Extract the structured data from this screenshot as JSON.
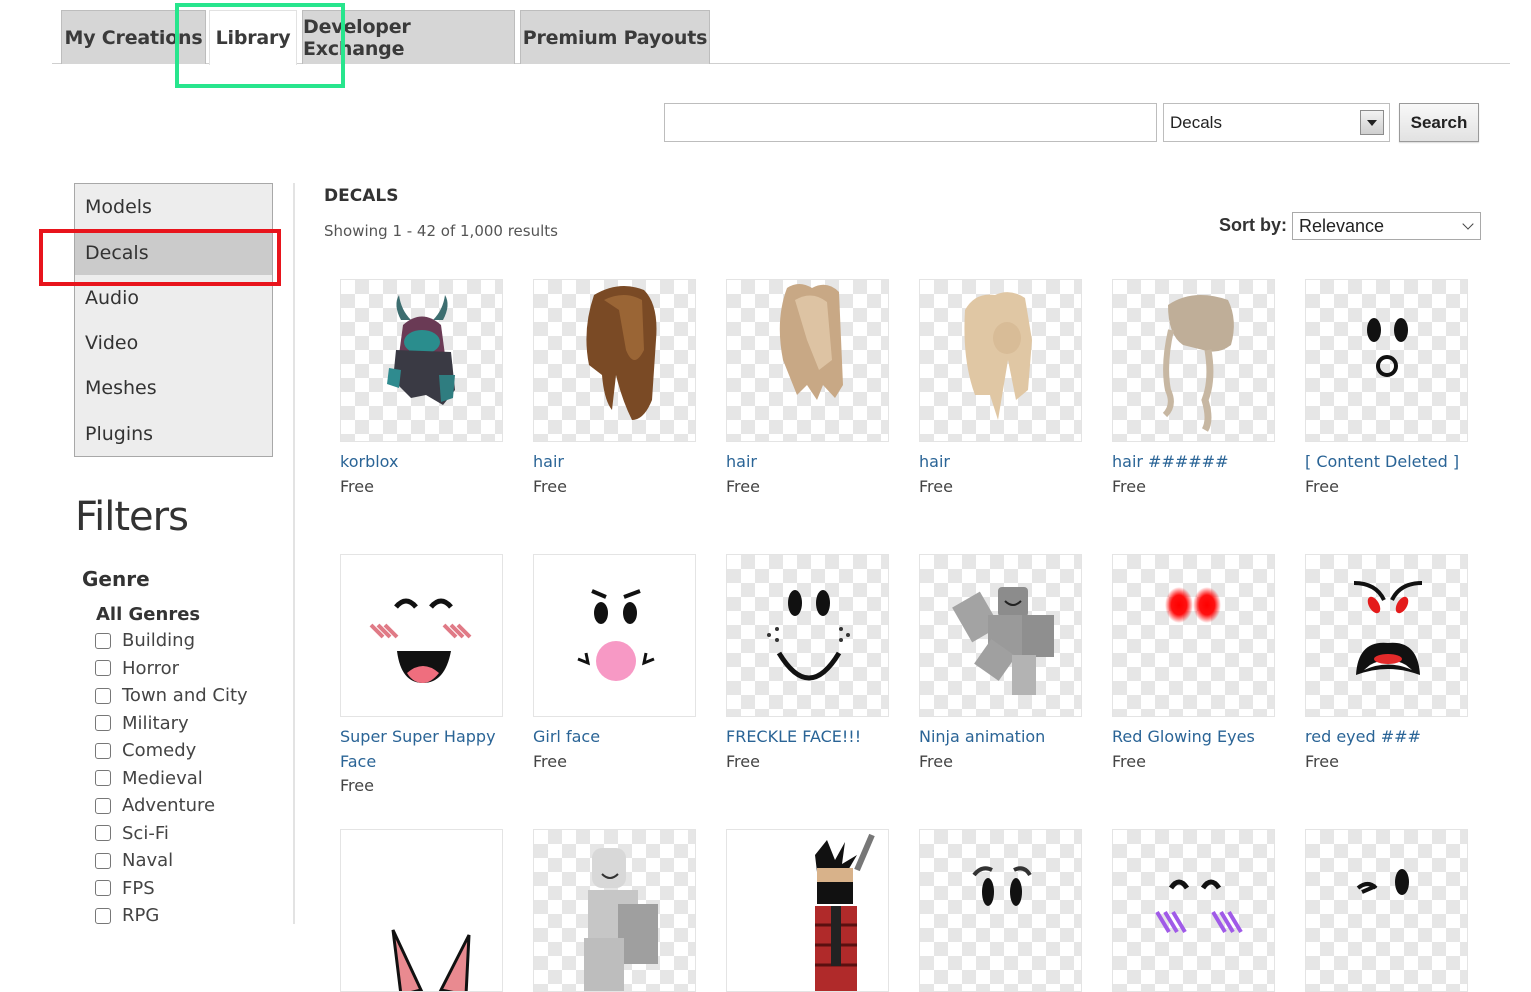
{
  "tabs": [
    {
      "label": "My Creations",
      "active": false
    },
    {
      "label": "Library",
      "active": true
    },
    {
      "label": "Developer Exchange",
      "active": false
    },
    {
      "label": "Premium Payouts",
      "active": false
    }
  ],
  "search": {
    "value": "",
    "placeholder": "",
    "category": "Decals",
    "button_label": "Search"
  },
  "sidenav": {
    "items": [
      {
        "label": "Models",
        "active": false
      },
      {
        "label": "Decals",
        "active": true
      },
      {
        "label": "Audio",
        "active": false
      },
      {
        "label": "Video",
        "active": false
      },
      {
        "label": "Meshes",
        "active": false
      },
      {
        "label": "Plugins",
        "active": false
      }
    ]
  },
  "filters": {
    "title": "Filters",
    "genre_title": "Genre",
    "all_genres_label": "All Genres",
    "genres": [
      "Building",
      "Horror",
      "Town and City",
      "Military",
      "Comedy",
      "Medieval",
      "Adventure",
      "Sci-Fi",
      "Naval",
      "FPS",
      "RPG"
    ]
  },
  "main": {
    "section_title": "DECALS",
    "result_count": "Showing 1 - 42 of 1,000 results",
    "sort_label": "Sort by:",
    "sort_value": "Relevance"
  },
  "items": [
    {
      "name": "korblox",
      "price": "Free",
      "icon": "armor-helmet-icon"
    },
    {
      "name": "hair",
      "price": "Free",
      "icon": "brown-hair-icon"
    },
    {
      "name": "hair",
      "price": "Free",
      "icon": "blonde-hair-icon"
    },
    {
      "name": "hair",
      "price": "Free",
      "icon": "blonde-ponytail-hair-icon"
    },
    {
      "name": "hair ######",
      "price": "Free",
      "icon": "wavy-hair-icon"
    },
    {
      "name": "[ Content Deleted ]",
      "price": "Free",
      "icon": "surprised-face-icon"
    },
    {
      "name": "Super Super Happy Face",
      "price": "Free",
      "icon": "super-happy-face-icon"
    },
    {
      "name": "Girl face",
      "price": "Free",
      "icon": "girl-face-icon"
    },
    {
      "name": "FRECKLE FACE!!!",
      "price": "Free",
      "icon": "freckle-face-icon"
    },
    {
      "name": "Ninja animation",
      "price": "Free",
      "icon": "ninja-figure-icon"
    },
    {
      "name": "Red Glowing Eyes",
      "price": "Free",
      "icon": "red-glowing-eyes-icon"
    },
    {
      "name": "red eyed ###",
      "price": "Free",
      "icon": "angry-red-eyed-face-icon"
    },
    {
      "name": "",
      "price": "",
      "icon": "cat-ears-icon"
    },
    {
      "name": "",
      "price": "",
      "icon": "white-figure-icon"
    },
    {
      "name": "",
      "price": "",
      "icon": "ninja-avatar-icon"
    },
    {
      "name": "",
      "price": "",
      "icon": "eyes-face-icon"
    },
    {
      "name": "",
      "price": "",
      "icon": "blush-happy-face-icon"
    },
    {
      "name": "",
      "price": "",
      "icon": "wink-face-icon"
    }
  ]
}
